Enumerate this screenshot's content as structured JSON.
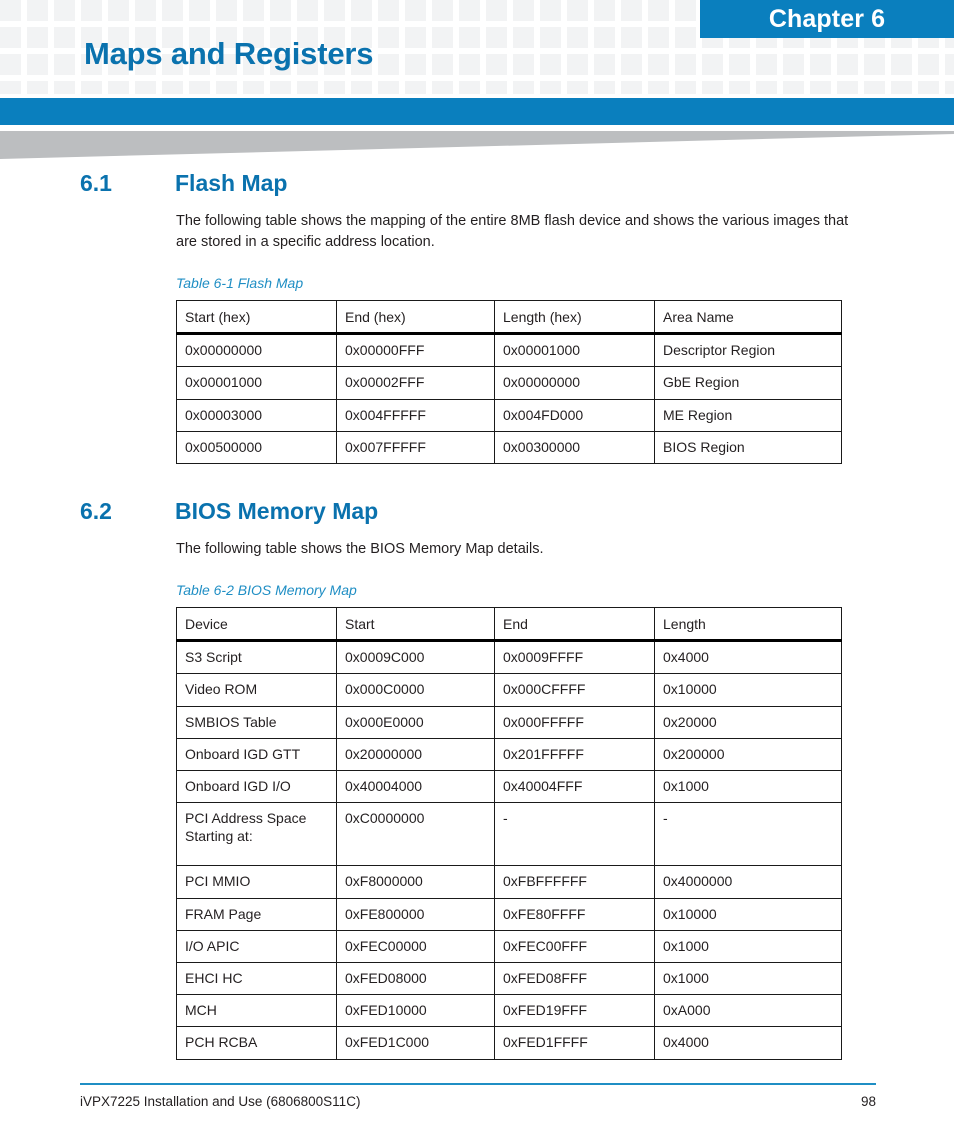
{
  "header": {
    "chapter_label": "Chapter 6",
    "chapter_title": "Maps and Registers",
    "accent_color": "#0a7fbe",
    "title_color": "#0a72ae",
    "grid_color": "#f2f3f4",
    "swoosh_color": "#bcbec0"
  },
  "sections": [
    {
      "number": "6.1",
      "name": "Flash Map",
      "intro": "The following table shows the mapping of the entire 8MB flash device and shows the various images that are stored in a specific address location.",
      "table": {
        "caption": "Table 6-1 Flash Map",
        "columns": [
          "Start (hex)",
          "End (hex)",
          "Length (hex)",
          "Area Name"
        ],
        "rows": [
          [
            "0x00000000",
            "0x00000FFF",
            "0x00001000",
            "Descriptor Region"
          ],
          [
            "0x00001000",
            "0x00002FFF",
            "0x00000000",
            "GbE Region"
          ],
          [
            "0x00003000",
            "0x004FFFFF",
            "0x004FD000",
            "ME Region"
          ],
          [
            "0x00500000",
            "0x007FFFFF",
            "0x00300000",
            "BIOS Region"
          ]
        ]
      }
    },
    {
      "number": "6.2",
      "name": "BIOS Memory Map",
      "intro": "The following table shows the BIOS Memory Map details.",
      "table": {
        "caption": "Table 6-2 BIOS Memory Map",
        "columns": [
          "Device",
          "Start",
          "End",
          "Length"
        ],
        "rows": [
          [
            "S3 Script",
            "0x0009C000",
            "0x0009FFFF",
            "0x4000"
          ],
          [
            "Video ROM",
            "0x000C0000",
            "0x000CFFFF",
            "0x10000"
          ],
          [
            "SMBIOS Table",
            "0x000E0000",
            "0x000FFFFF",
            "0x20000"
          ],
          [
            "Onboard IGD GTT",
            "0x20000000",
            "0x201FFFFF",
            "0x200000"
          ],
          [
            "Onboard IGD I/O",
            "0x40004000",
            "0x40004FFF",
            "0x1000"
          ],
          [
            "PCI Address Space Starting at:",
            "0xC0000000",
            "-",
            "-"
          ],
          [
            "PCI MMIO",
            "0xF8000000",
            "0xFBFFFFFF",
            "0x4000000"
          ],
          [
            "FRAM Page",
            "0xFE800000",
            "0xFE80FFFF",
            "0x10000"
          ],
          [
            "I/O APIC",
            "0xFEC00000",
            "0xFEC00FFF",
            "0x1000"
          ],
          [
            "EHCI HC",
            "0xFED08000",
            "0xFED08FFF",
            "0x1000"
          ],
          [
            "MCH",
            "0xFED10000",
            "0xFED19FFF",
            "0xA000"
          ],
          [
            "PCH RCBA",
            "0xFED1C000",
            "0xFED1FFFF",
            "0x4000"
          ]
        ]
      }
    }
  ],
  "footer": {
    "document": "iVPX7225 Installation and Use (6806800S11C)",
    "page_number": "98",
    "rule_color": "#1f8ec4"
  }
}
